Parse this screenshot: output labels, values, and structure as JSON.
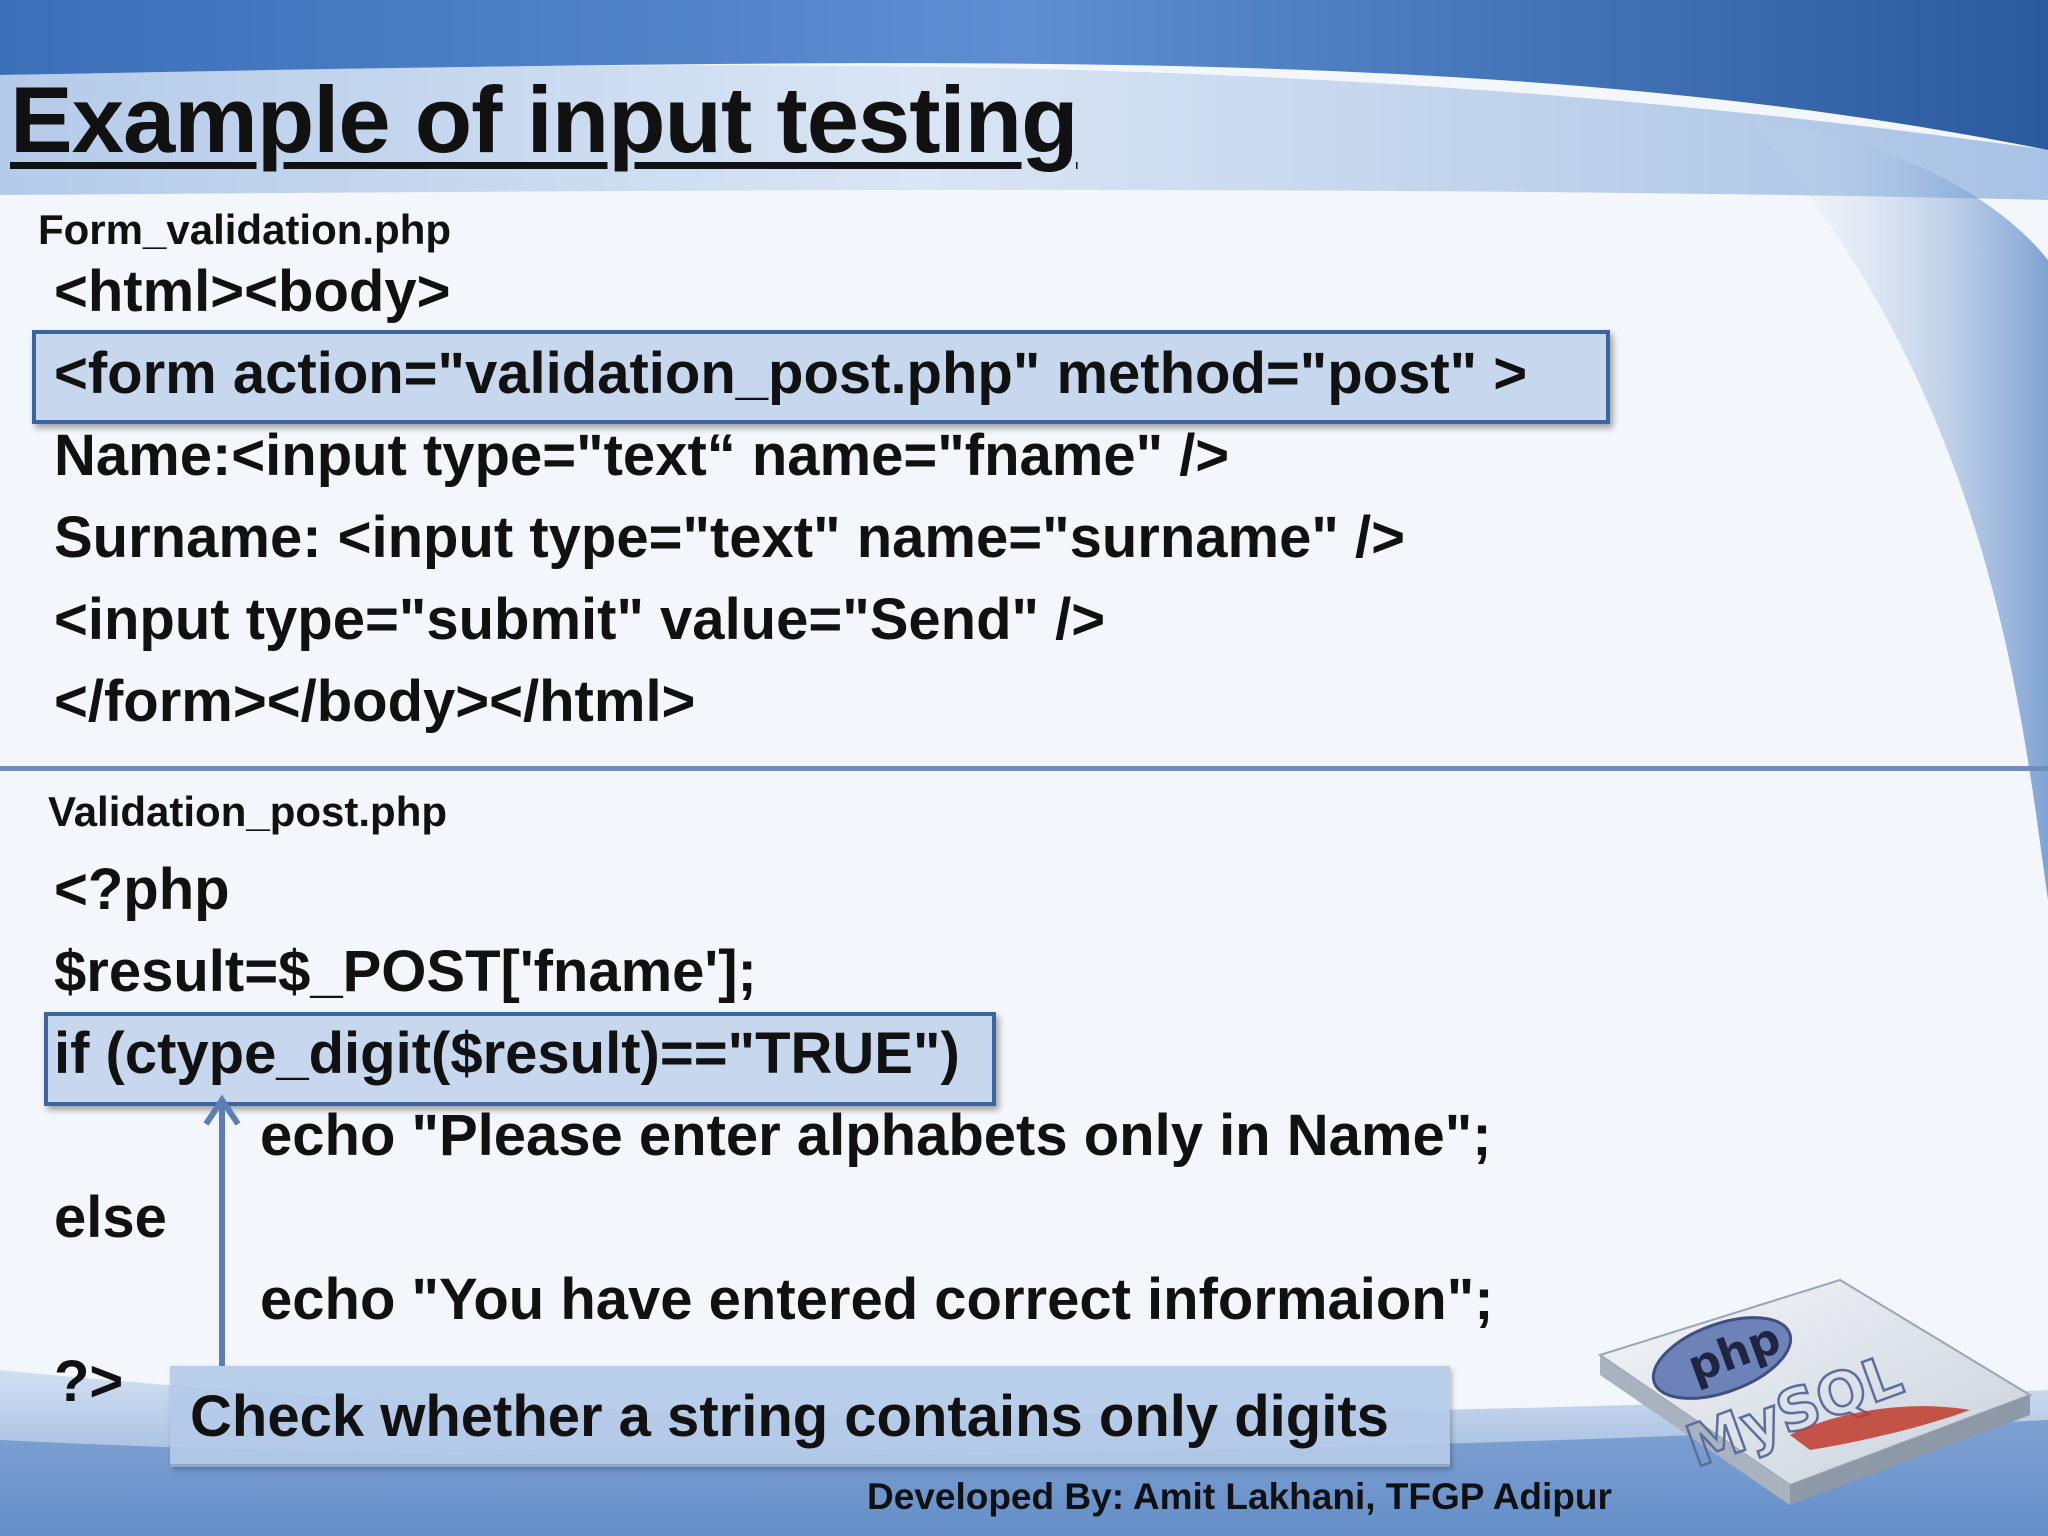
{
  "slide": {
    "title": "Example of input testing",
    "form_file": {
      "label": "Form_validation.php",
      "lines": [
        "<html><body>",
        "<form action=\"validation_post.php\" method=\"post\" >",
        "Name:<input type=\"text“ name=\"fname\" />",
        "Surname: <input type=\"text\" name=\"surname\" />",
        "<input type=\"submit\" value=\"Send\" />",
        "</form></body></html>"
      ]
    },
    "post_file": {
      "label": "Validation_post.php",
      "lines": [
        "<?php",
        "$result=$_POST['fname'];",
        "if (ctype_digit($result)==\"TRUE\")",
        "echo \"Please enter alphabets only in Name\";",
        "else",
        "echo \"You have entered correct informaion\";",
        "?>"
      ]
    },
    "callout": "Check whether a string contains only digits",
    "footer": "Developed By: Amit Lakhani, TFGP Adipur",
    "logo": {
      "icon": "php-mysql-logo-icon",
      "php_text": "php",
      "mysql_text": "MySQL"
    },
    "colors": {
      "highlight_border": "#3a65a0",
      "highlight_fill": "#a3bee4",
      "header_band": "#5d88c4",
      "text": "#111111"
    }
  }
}
